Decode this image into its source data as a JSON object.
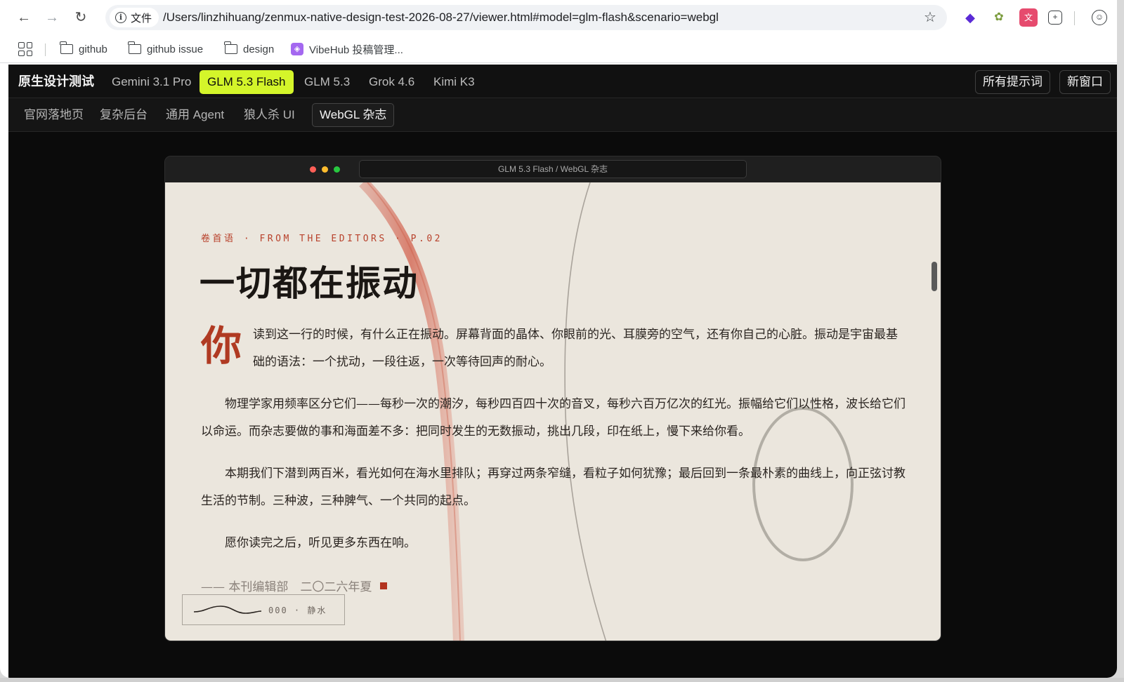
{
  "browser": {
    "site_chip": "文件",
    "url": "/Users/linzhihuang/zenmux-native-design-test-2026-08-27/viewer.html#model=glm-flash&scenario=webgl",
    "bookmarks": [
      {
        "label": "github"
      },
      {
        "label": "github issue"
      },
      {
        "label": "design"
      },
      {
        "label": "VibeHub 投稿管理..."
      }
    ]
  },
  "app": {
    "brand": "原生设计测试",
    "model_tabs": [
      {
        "label": "Gemini 3.1 Pro"
      },
      {
        "label": "GLM 5.3 Flash"
      },
      {
        "label": "GLM 5.3"
      },
      {
        "label": "Grok 4.6"
      },
      {
        "label": "Kimi K3"
      }
    ],
    "active_model": "GLM 5.3 Flash",
    "right_buttons": {
      "all_prompts": "所有提示词",
      "new_window": "新窗口"
    },
    "scenario_tabs": [
      {
        "label": "官网落地页"
      },
      {
        "label": "复杂后台"
      },
      {
        "label": "通用 Agent"
      },
      {
        "label": "狼人杀 UI"
      },
      {
        "label": "WebGL 杂志"
      }
    ],
    "active_scenario": "WebGL 杂志",
    "accent_color": "#d4f52a"
  },
  "preview": {
    "title": "GLM 5.3 Flash / WebGL 杂志",
    "kicker": "卷首语 · FROM THE EDITORS · P.02",
    "headline": "一切都在振动",
    "dropcap": "你",
    "para1": "读到这一行的时候，有什么正在振动。屏幕背面的晶体、你眼前的光、耳膜旁的空气，还有你自己的心脏。振动是宇宙最基础的语法：一个扰动，一段往返，一次等待回声的耐心。",
    "para2": "物理学家用频率区分它们——每秒一次的潮汐，每秒四百四十次的音叉，每秒六百万亿次的红光。振幅给它们以性格，波长给它们以命运。而杂志要做的事和海面差不多：把同时发生的无数振动，挑出几段，印在纸上，慢下来给你看。",
    "para3": "本期我们下潜到两百米，看光如何在海水里排队；再穿过两条窄缝，看粒子如何犹豫；最后回到一条最朴素的曲线上，向正弦讨教生活的节制。三种波，三种脾气、一个共同的起点。",
    "para4": "愿你读完之后，听见更多东西在响。",
    "signature": "—— 本刊编辑部　二〇二六年夏",
    "wave_label": "000 · 静水",
    "colors": {
      "paper": "#ebe6dd",
      "accent_red": "#b8412b"
    }
  }
}
